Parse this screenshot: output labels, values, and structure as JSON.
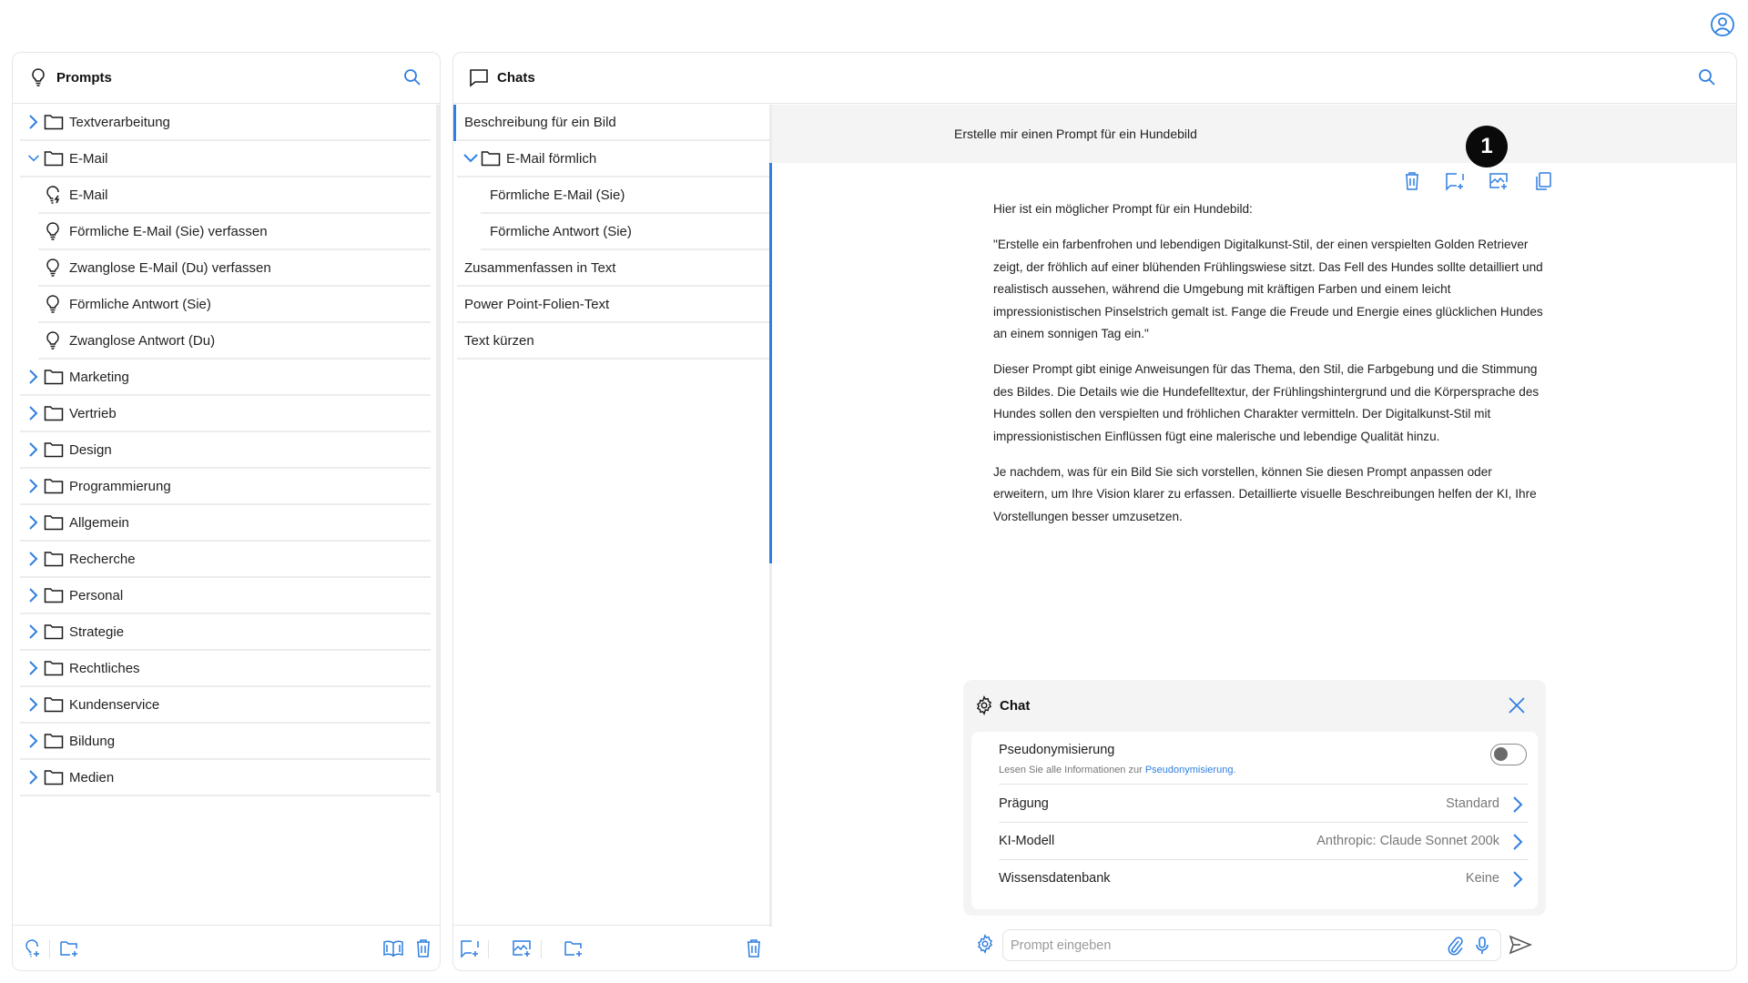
{
  "colors": {
    "accent": "#2f7fe0",
    "panel_border": "#e6e6e6",
    "message_bg": "#f4f4f4"
  },
  "header": {
    "user_icon": "user-circle-icon"
  },
  "prompts": {
    "title": "Prompts",
    "title_icon": "lightbulb-icon",
    "search_icon": "search-icon",
    "tree": [
      {
        "type": "folder",
        "label": "Textverarbeitung",
        "expanded": false
      },
      {
        "type": "folder",
        "label": "E-Mail",
        "expanded": true
      },
      {
        "type": "prompt",
        "label": "E-Mail",
        "icon": "lightbulb-bolt-icon"
      },
      {
        "type": "prompt",
        "label": "Förmliche E-Mail (Sie) verfassen",
        "icon": "lightbulb-icon"
      },
      {
        "type": "prompt",
        "label": "Zwanglose E-Mail (Du) verfassen",
        "icon": "lightbulb-icon"
      },
      {
        "type": "prompt",
        "label": "Förmliche Antwort (Sie)",
        "icon": "lightbulb-icon"
      },
      {
        "type": "prompt",
        "label": "Zwanglose Antwort (Du)",
        "icon": "lightbulb-icon"
      },
      {
        "type": "folder",
        "label": "Marketing",
        "expanded": false
      },
      {
        "type": "folder",
        "label": "Vertrieb",
        "expanded": false
      },
      {
        "type": "folder",
        "label": "Design",
        "expanded": false
      },
      {
        "type": "folder",
        "label": "Programmierung",
        "expanded": false
      },
      {
        "type": "folder",
        "label": "Allgemein",
        "expanded": false
      },
      {
        "type": "folder",
        "label": "Recherche",
        "expanded": false
      },
      {
        "type": "folder",
        "label": "Personal",
        "expanded": false
      },
      {
        "type": "folder",
        "label": "Strategie",
        "expanded": false
      },
      {
        "type": "folder",
        "label": "Rechtliches",
        "expanded": false
      },
      {
        "type": "folder",
        "label": "Kundenservice",
        "expanded": false
      },
      {
        "type": "folder",
        "label": "Bildung",
        "expanded": false
      },
      {
        "type": "folder",
        "label": "Medien",
        "expanded": false
      }
    ],
    "footer_icons": [
      "new-prompt-icon",
      "new-folder-icon",
      "library-icon",
      "trash-icon"
    ]
  },
  "chats": {
    "title": "Chats",
    "title_icon": "chat-bubble-icon",
    "search_icon": "search-icon",
    "list": [
      {
        "type": "chat",
        "label": "Beschreibung für ein Bild",
        "active": true
      },
      {
        "type": "folder",
        "label": "E-Mail förmlich",
        "expanded": true
      },
      {
        "type": "chat",
        "label": "Förmliche E-Mail (Sie)",
        "child": true
      },
      {
        "type": "chat",
        "label": "Förmliche Antwort (Sie)",
        "child": true
      },
      {
        "type": "chat",
        "label": "Zusammenfassen in Text"
      },
      {
        "type": "chat",
        "label": "Power Point-Folien-Text"
      },
      {
        "type": "chat",
        "label": "Text kürzen"
      }
    ],
    "footer_icons": [
      "new-chat-icon",
      "new-image-chat-icon",
      "new-folder-icon",
      "trash-icon"
    ]
  },
  "conversation": {
    "user_message": "Erstelle mir einen Prompt für ein Hundebild",
    "badge": "1",
    "message_actions": [
      "trash-icon",
      "new-chat-icon",
      "new-image-icon",
      "copy-icon"
    ],
    "response": [
      "Hier ist ein möglicher Prompt für ein Hundebild:",
      "\"Erstelle ein farbenfrohen und lebendigen Digitalkunst-Stil, der einen verspielten Golden Retriever zeigt, der fröhlich auf einer blühenden Frühlingswiese sitzt. Das Fell des Hundes sollte detailliert und realistisch aussehen, während die Umgebung mit kräftigen Farben und einem leicht impressionistischen Pinselstrich gemalt ist. Fange die Freude und Energie eines glücklichen Hundes an einem sonnigen Tag ein.\"",
      "Dieser Prompt gibt einige Anweisungen für das Thema, den Stil, die Farbgebung und die Stimmung des Bildes. Die Details wie die Hundefelltextur, der Frühlingshintergrund und die Körpersprache des Hundes sollen den verspielten und fröhlichen Charakter vermitteln. Der Digitalkunst-Stil mit impressionistischen Einflüssen fügt eine malerische und lebendige Qualität hinzu.",
      "Je nachdem, was für ein Bild Sie sich vorstellen, können Sie diesen Prompt anpassen oder erweitern, um Ihre Vision klarer zu erfassen. Detaillierte visuelle Beschreibungen helfen der KI, Ihre Vorstellungen besser umzusetzen."
    ]
  },
  "settings_popover": {
    "title": "Chat",
    "pseudonymization": {
      "label": "Pseudonymisierung",
      "enabled": false,
      "info_prefix": "Lesen Sie alle Informationen zur ",
      "info_link": "Pseudonymisierung",
      "info_suffix": "."
    },
    "rows": [
      {
        "label": "Prägung",
        "value": "Standard"
      },
      {
        "label": "KI-Modell",
        "value": "Anthropic: Claude Sonnet 200k"
      },
      {
        "label": "Wissensdatenbank",
        "value": "Keine"
      }
    ]
  },
  "input": {
    "placeholder": "Prompt eingeben",
    "value": ""
  }
}
